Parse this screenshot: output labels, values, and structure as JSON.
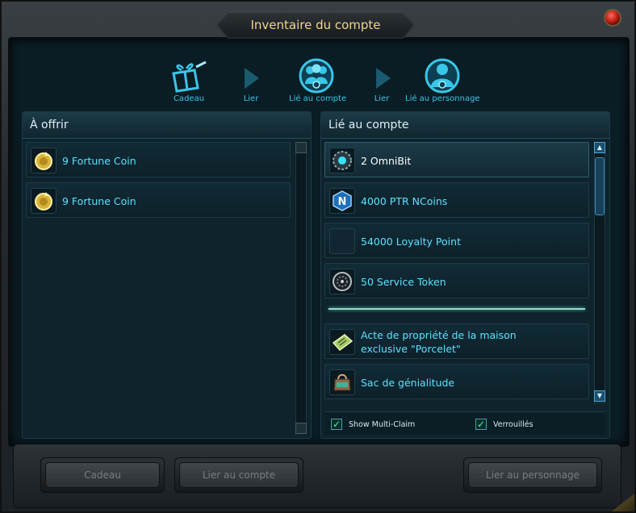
{
  "window": {
    "title": "Inventaire du compte"
  },
  "steps": [
    {
      "label": "Cadeau",
      "icon": "gift-icon"
    },
    {
      "label": "Lier",
      "icon": "arrow-right-icon"
    },
    {
      "label": "Lié au compte",
      "icon": "account-bound-icon"
    },
    {
      "label": "Lier",
      "icon": "arrow-right-icon"
    },
    {
      "label": "Lié au personnage",
      "icon": "character-bound-icon"
    }
  ],
  "left_panel": {
    "title": "À offrir",
    "items": [
      {
        "label": "9 Fortune Coin",
        "icon": "fortune-coin-icon"
      },
      {
        "label": "9 Fortune Coin",
        "icon": "fortune-coin-icon"
      }
    ]
  },
  "right_panel": {
    "title": "Lié au compte",
    "items": [
      {
        "label": "2 OmniBit",
        "icon": "omnibit-icon",
        "selected": true
      },
      {
        "label": "4000 PTR NCoins",
        "icon": "ncoin-icon"
      },
      {
        "label": "54000 Loyalty Point",
        "icon": "loyalty-point-icon"
      },
      {
        "label": "50 Service Token",
        "icon": "service-token-icon"
      }
    ],
    "items_after_divider": [
      {
        "label_line1": "Acte de propriété de la maison",
        "label_line2": "exclusive \"Porcelet\"",
        "icon": "deed-icon"
      },
      {
        "label": "Sac de génialitude",
        "icon": "bag-icon"
      }
    ],
    "checkboxes": [
      {
        "label": "Show Multi-Claim",
        "checked": true
      },
      {
        "label": "Verrouillés",
        "checked": true
      }
    ]
  },
  "buttons": {
    "gift": "Cadeau",
    "bind_account": "Lier au compte",
    "bind_character": "Lier au personnage"
  },
  "colors": {
    "accent": "#39c6e8",
    "item_text": "#5ce1ff",
    "title_text": "#f1d58a"
  }
}
